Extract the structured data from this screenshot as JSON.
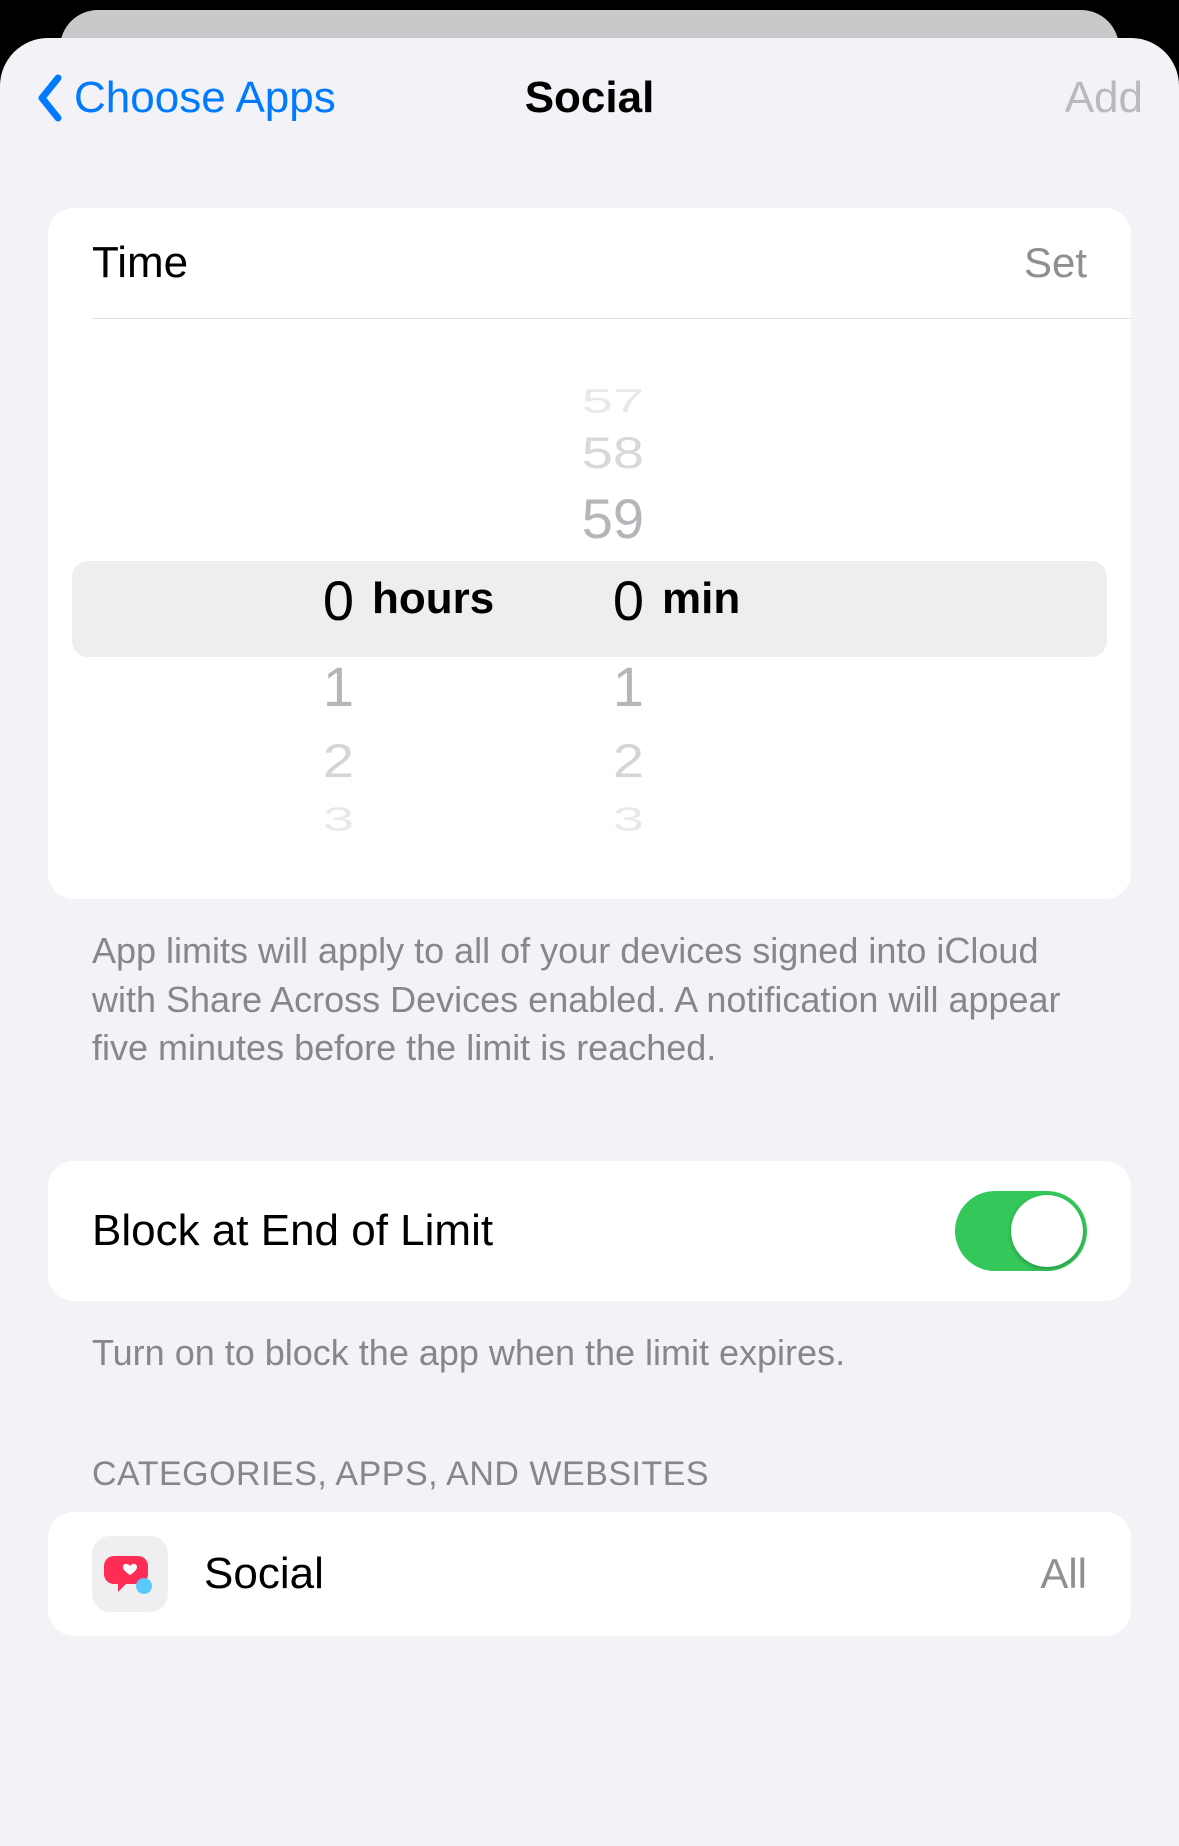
{
  "nav": {
    "back_label": "Choose Apps",
    "title": "Social",
    "action_label": "Add"
  },
  "time_section": {
    "label": "Time",
    "value_label": "Set",
    "hours_unit": "hours",
    "minutes_unit": "min",
    "hours_selected": "0",
    "hours_after": [
      "1",
      "2",
      "3"
    ],
    "minutes_before": [
      "57",
      "58",
      "59"
    ],
    "minutes_selected": "0",
    "minutes_after": [
      "1",
      "2",
      "3"
    ],
    "footer": "App limits will apply to all of your devices signed into iCloud with Share Across Devices enabled. A notification will appear five minutes before the limit is reached."
  },
  "block_section": {
    "label": "Block at End of Limit",
    "enabled": true,
    "footer": "Turn on to block the app when the limit expires."
  },
  "categories_section": {
    "header": "CATEGORIES, APPS, AND WEBSITES",
    "items": [
      {
        "name": "Social",
        "scope": "All"
      }
    ]
  }
}
